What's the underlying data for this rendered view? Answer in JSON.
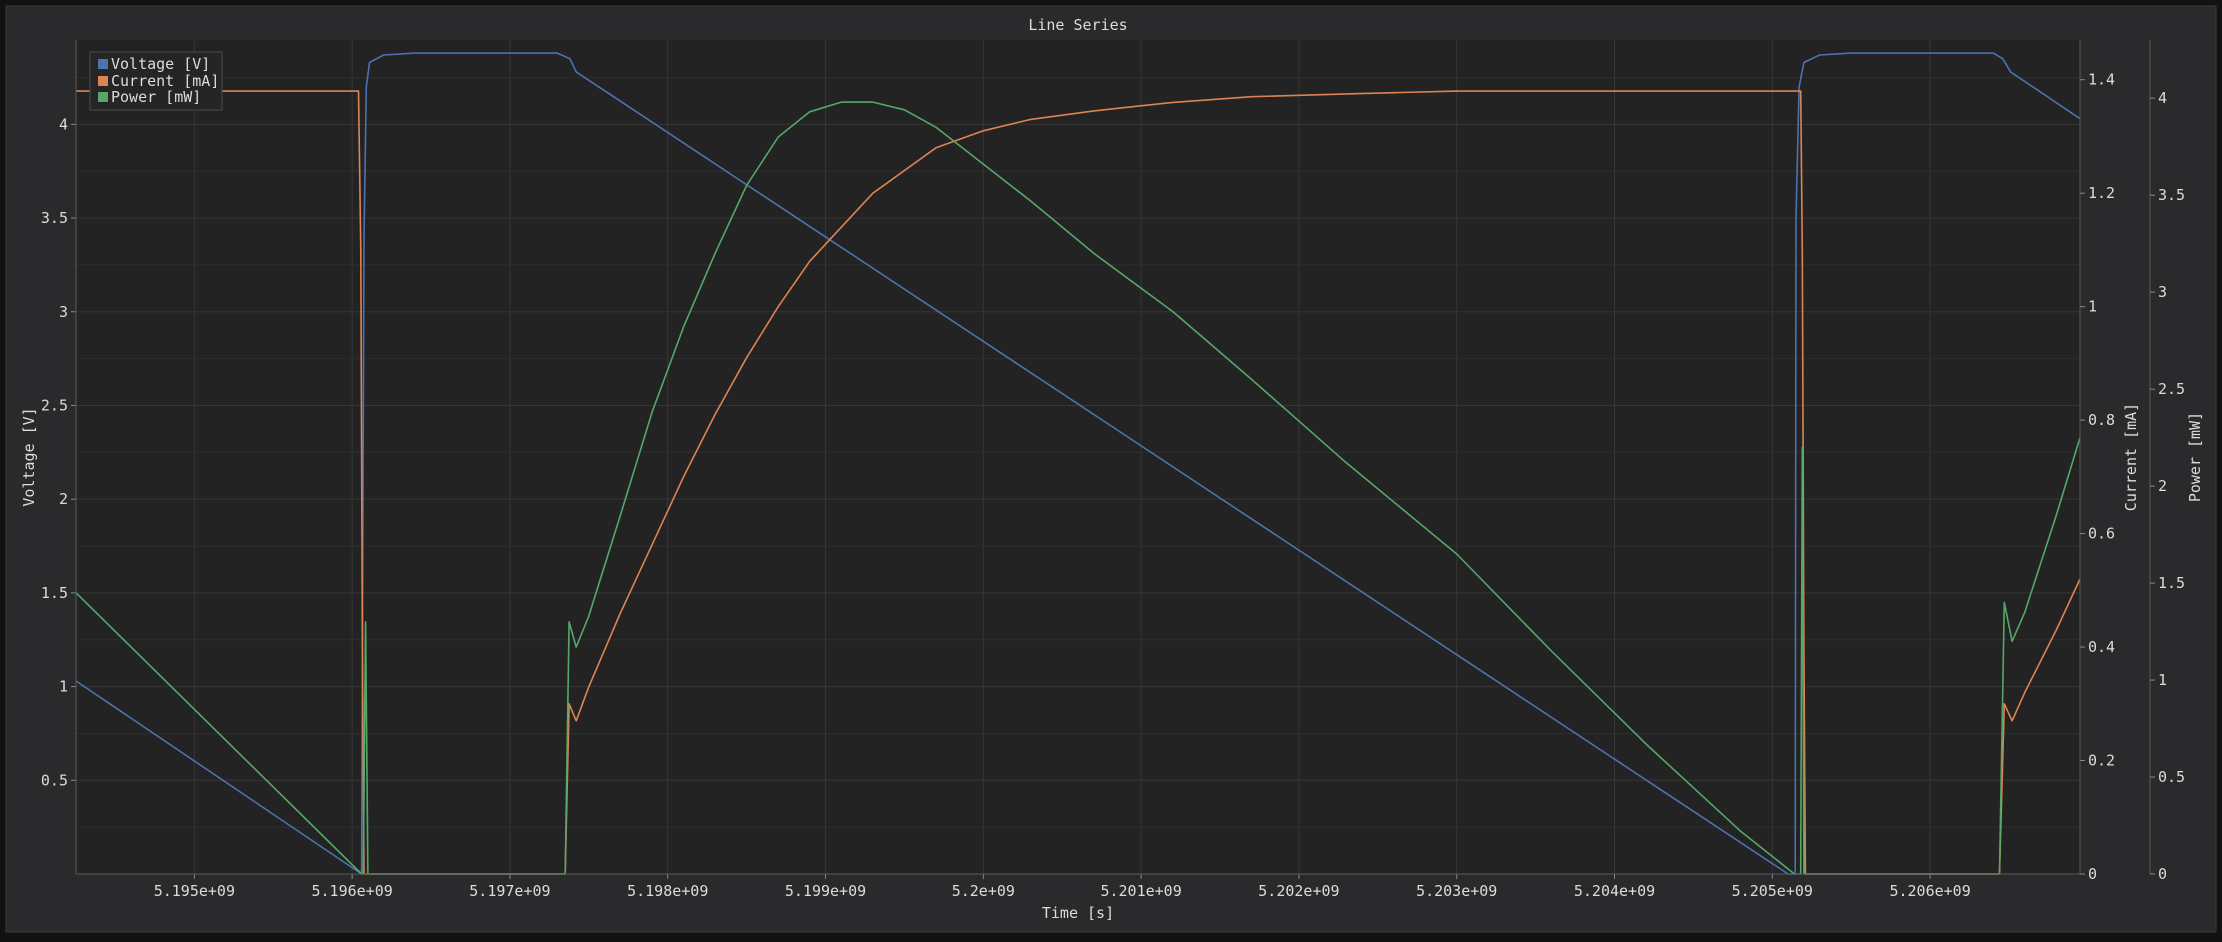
{
  "window": {
    "title": "Line Series"
  },
  "chart_data": {
    "type": "line",
    "title": "Line Series",
    "xlabel": "Time [s]",
    "ylabels": [
      "Voltage [V]",
      "Current [mA]",
      "Power [mW]"
    ],
    "xlim": [
      5194250000,
      5206950000
    ],
    "ylim_voltage": [
      0,
      4.45
    ],
    "ylim_current": [
      0,
      1.47
    ],
    "ylim_power": [
      0,
      4.3
    ],
    "x_ticks": [
      5195000000,
      5196000000,
      5197000000,
      5198000000,
      5199000000,
      5200000000,
      5201000000,
      5202000000,
      5203000000,
      5204000000,
      5205000000,
      5206000000
    ],
    "x_tick_labels": [
      "5.195e+09",
      "5.196e+09",
      "5.197e+09",
      "5.198e+09",
      "5.199e+09",
      "5.2e+09",
      "5.201e+09",
      "5.202e+09",
      "5.203e+09",
      "5.204e+09",
      "5.205e+09",
      "5.206e+09"
    ],
    "y_voltage_ticks": [
      0.5,
      1,
      1.5,
      2,
      2.5,
      3,
      3.5,
      4
    ],
    "y_voltage_tick_labels": [
      "0.5",
      "1",
      "1.5",
      "2",
      "2.5",
      "3",
      "3.5",
      "4"
    ],
    "y_current_ticks": [
      0,
      0.2,
      0.4,
      0.6,
      0.8,
      1,
      1.2,
      1.4
    ],
    "y_current_tick_labels": [
      "0",
      "0.2",
      "0.4",
      "0.6",
      "0.8",
      "1",
      "1.2",
      "1.4"
    ],
    "y_power_ticks": [
      0,
      0.5,
      1,
      1.5,
      2,
      2.5,
      3,
      3.5,
      4
    ],
    "y_power_tick_labels": [
      "0",
      "0.5",
      "1",
      "1.5",
      "2",
      "2.5",
      "3",
      "3.5",
      "4"
    ],
    "grid": true,
    "legend_position": "top-left",
    "series": [
      {
        "name": "Voltage [V]",
        "axis": "voltage",
        "color": "#4c72b0",
        "points": [
          [
            5194250000,
            1.03
          ],
          [
            5196060000,
            0.0
          ],
          [
            5196075000,
            3.4
          ],
          [
            5196090000,
            4.2
          ],
          [
            5196110000,
            4.33
          ],
          [
            5196200000,
            4.37
          ],
          [
            5196400000,
            4.38
          ],
          [
            5197300000,
            4.38
          ],
          [
            5197380000,
            4.35
          ],
          [
            5197420000,
            4.28
          ],
          [
            5205100000,
            0.0
          ],
          [
            5205145000,
            0.0
          ],
          [
            5205150000,
            3.5
          ],
          [
            5205170000,
            4.2
          ],
          [
            5205200000,
            4.33
          ],
          [
            5205300000,
            4.37
          ],
          [
            5205500000,
            4.38
          ],
          [
            5206400000,
            4.38
          ],
          [
            5206460000,
            4.35
          ],
          [
            5206510000,
            4.28
          ],
          [
            5206950000,
            4.03
          ]
        ]
      },
      {
        "name": "Current [mA]",
        "axis": "current",
        "color": "#dd8452",
        "points": [
          [
            5194250000,
            1.38
          ],
          [
            5196040000,
            1.38
          ],
          [
            5196055000,
            1.1
          ],
          [
            5196065000,
            0.4
          ],
          [
            5196075000,
            0.0
          ],
          [
            5196090000,
            0.0
          ],
          [
            5197350000,
            0.0
          ],
          [
            5197375000,
            0.3
          ],
          [
            5197420000,
            0.27
          ],
          [
            5197500000,
            0.33
          ],
          [
            5197700000,
            0.46
          ],
          [
            5197900000,
            0.58
          ],
          [
            5198100000,
            0.7
          ],
          [
            5198300000,
            0.81
          ],
          [
            5198500000,
            0.91
          ],
          [
            5198700000,
            1.0
          ],
          [
            5198900000,
            1.08
          ],
          [
            5199100000,
            1.14
          ],
          [
            5199300000,
            1.2
          ],
          [
            5199500000,
            1.24
          ],
          [
            5199700000,
            1.28
          ],
          [
            5200000000,
            1.31
          ],
          [
            5200300000,
            1.33
          ],
          [
            5200700000,
            1.345
          ],
          [
            5201200000,
            1.36
          ],
          [
            5201700000,
            1.37
          ],
          [
            5202300000,
            1.375
          ],
          [
            5203000000,
            1.38
          ],
          [
            5204000000,
            1.38
          ],
          [
            5205180000,
            1.38
          ],
          [
            5205190000,
            1.1
          ],
          [
            5205200000,
            0.4
          ],
          [
            5205210000,
            0.0
          ],
          [
            5205230000,
            0.0
          ],
          [
            5206440000,
            0.0
          ],
          [
            5206470000,
            0.3
          ],
          [
            5206520000,
            0.27
          ],
          [
            5206600000,
            0.32
          ],
          [
            5206800000,
            0.43
          ],
          [
            5206950000,
            0.52
          ]
        ]
      },
      {
        "name": "Power [mW]",
        "axis": "power",
        "color": "#55a868",
        "points": [
          [
            5194250000,
            1.45
          ],
          [
            5196060000,
            0.0
          ],
          [
            5196070000,
            0.0
          ],
          [
            5196075000,
            0.4
          ],
          [
            5196085000,
            1.3
          ],
          [
            5196100000,
            0.0
          ],
          [
            5197350000,
            0.0
          ],
          [
            5197375000,
            1.3
          ],
          [
            5197420000,
            1.17
          ],
          [
            5197500000,
            1.33
          ],
          [
            5197700000,
            1.85
          ],
          [
            5197900000,
            2.38
          ],
          [
            5198100000,
            2.82
          ],
          [
            5198300000,
            3.2
          ],
          [
            5198500000,
            3.55
          ],
          [
            5198700000,
            3.8
          ],
          [
            5198900000,
            3.93
          ],
          [
            5199100000,
            3.98
          ],
          [
            5199300000,
            3.98
          ],
          [
            5199500000,
            3.94
          ],
          [
            5199700000,
            3.85
          ],
          [
            5200000000,
            3.66
          ],
          [
            5200300000,
            3.47
          ],
          [
            5200700000,
            3.2
          ],
          [
            5201200000,
            2.9
          ],
          [
            5201700000,
            2.55
          ],
          [
            5202300000,
            2.12
          ],
          [
            5203000000,
            1.65
          ],
          [
            5203600000,
            1.15
          ],
          [
            5204200000,
            0.67
          ],
          [
            5204800000,
            0.22
          ],
          [
            5205140000,
            0.0
          ],
          [
            5205180000,
            0.0
          ],
          [
            5205190000,
            2.2
          ],
          [
            5205200000,
            0.0
          ],
          [
            5206440000,
            0.0
          ],
          [
            5206470000,
            1.4
          ],
          [
            5206520000,
            1.2
          ],
          [
            5206600000,
            1.35
          ],
          [
            5206800000,
            1.85
          ],
          [
            5206950000,
            2.25
          ]
        ]
      }
    ]
  }
}
